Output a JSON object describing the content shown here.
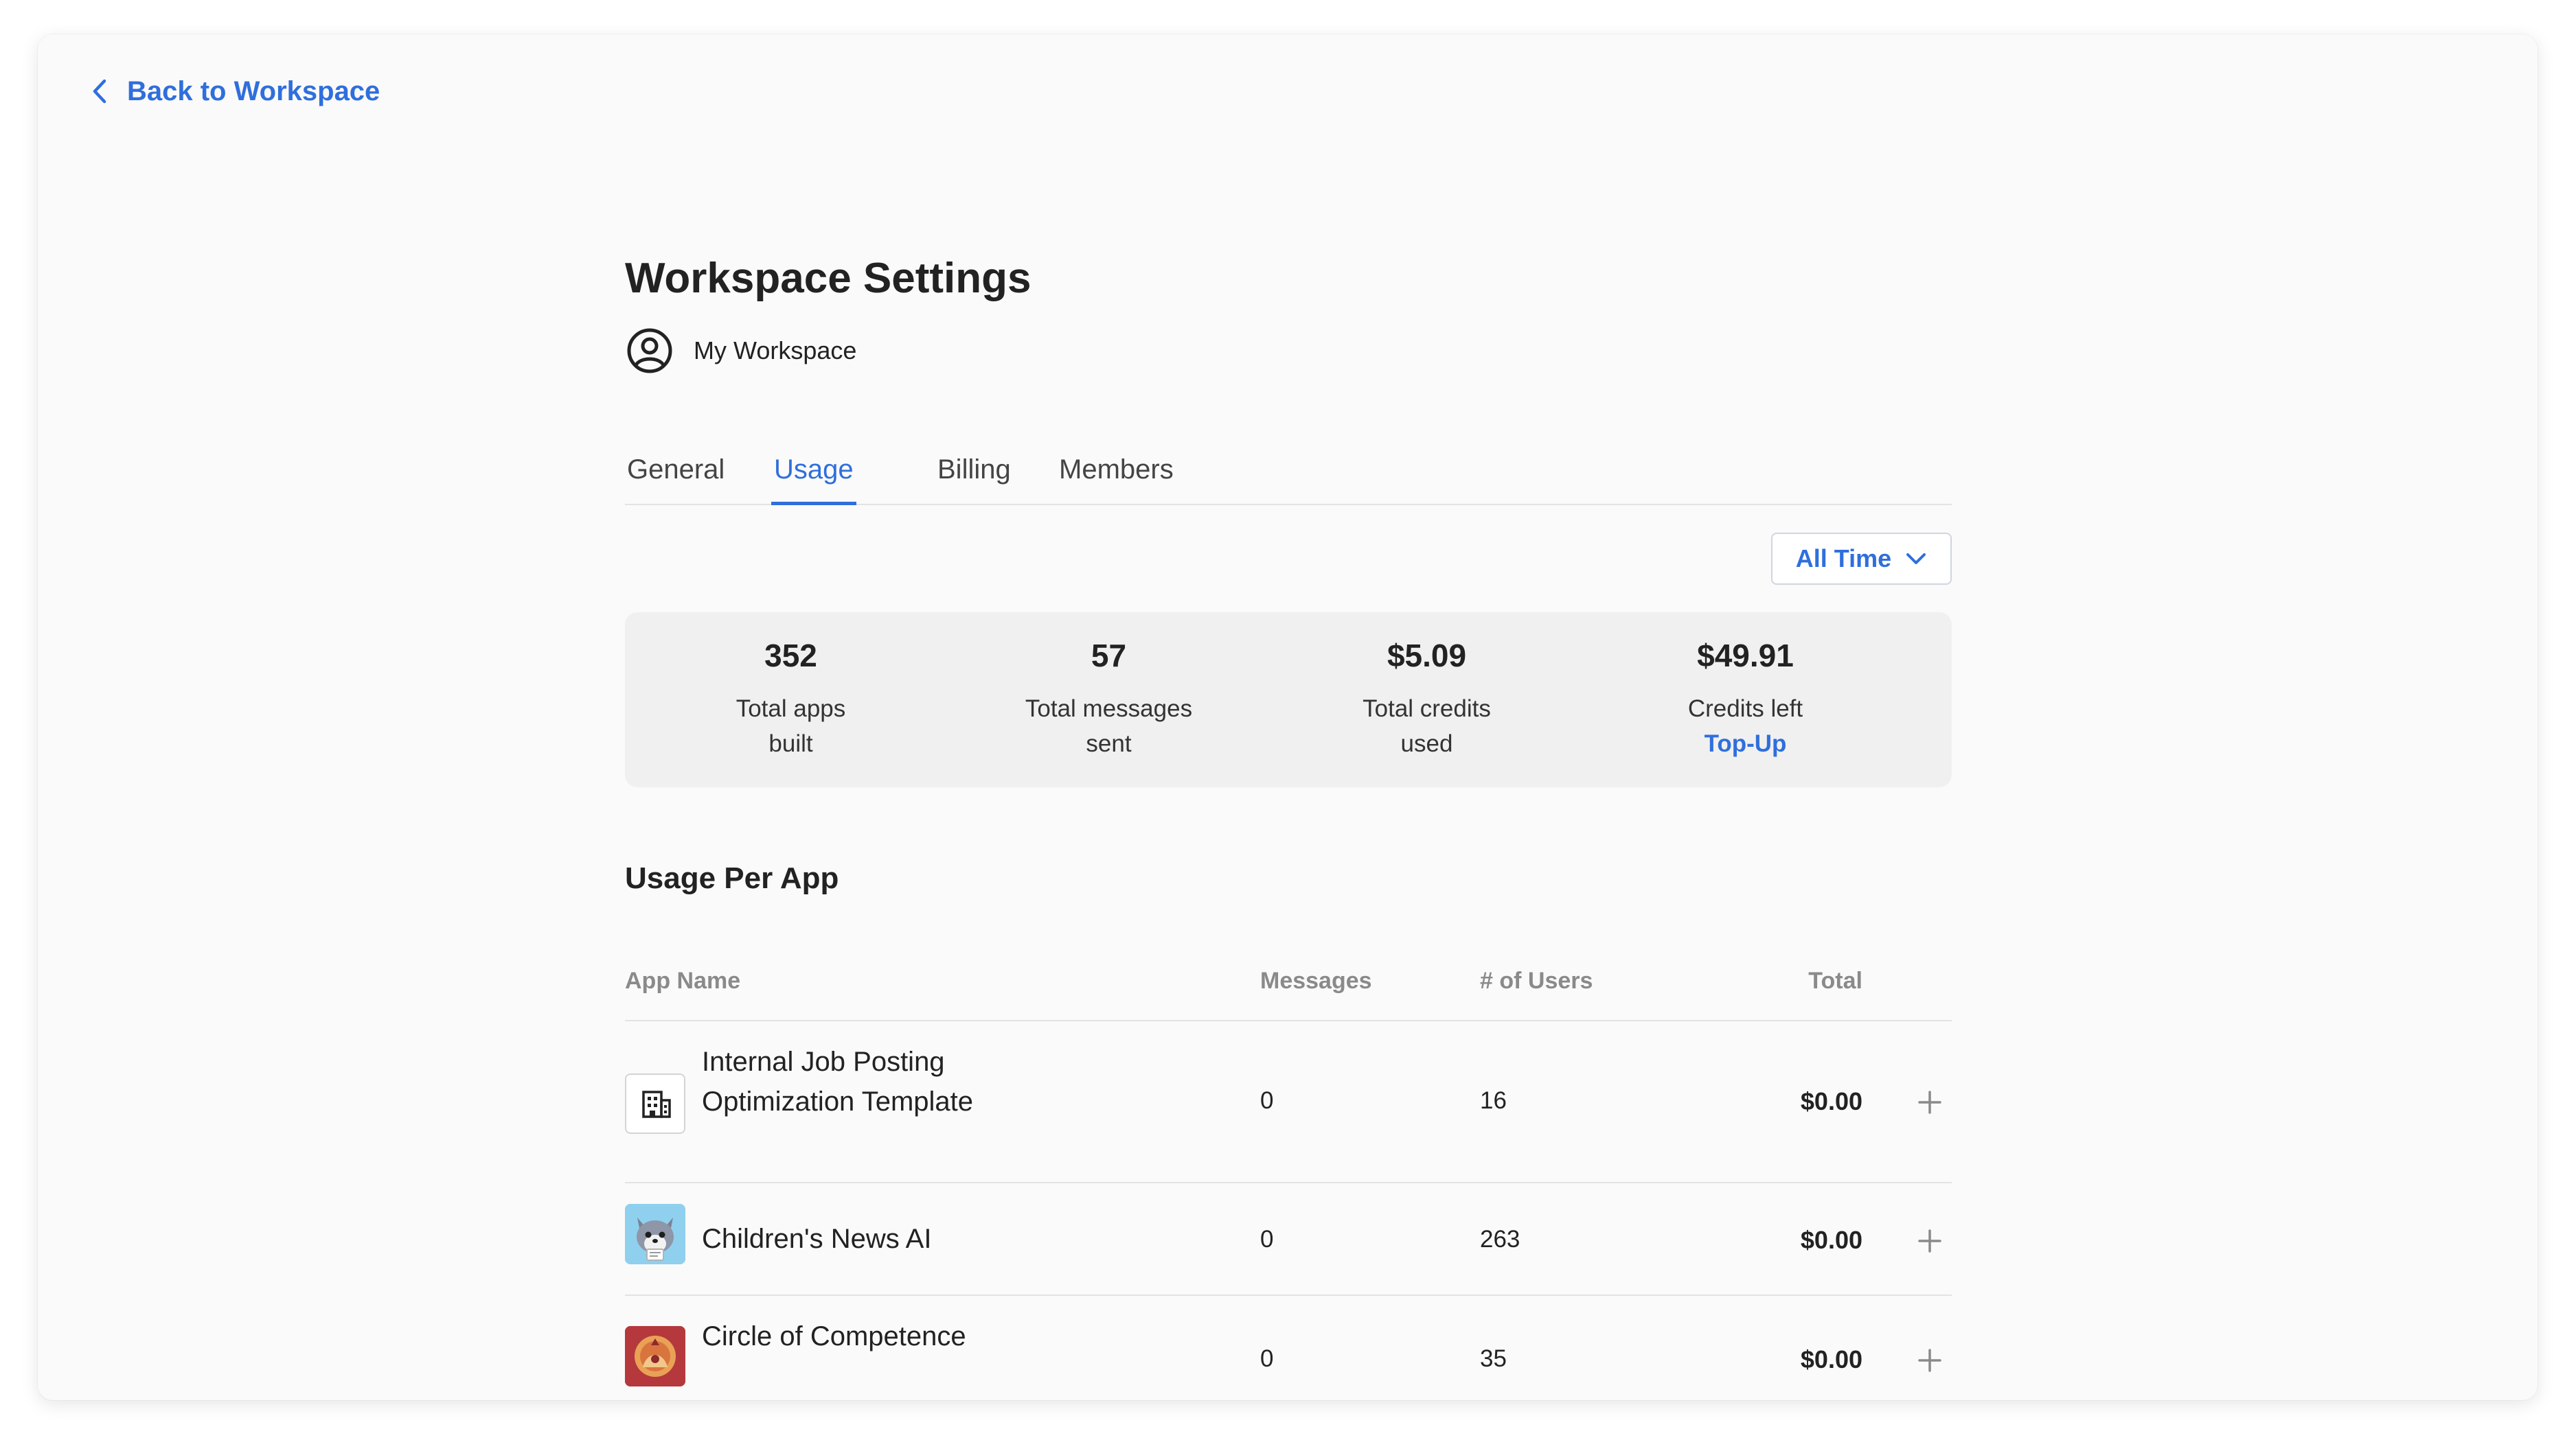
{
  "nav": {
    "back_label": "Back to Workspace"
  },
  "header": {
    "title": "Workspace Settings",
    "workspace_name": "My Workspace"
  },
  "tabs": [
    {
      "label": "General",
      "active": false
    },
    {
      "label": "Usage",
      "active": true
    },
    {
      "label": "Billing",
      "active": false
    },
    {
      "label": "Members",
      "active": false
    }
  ],
  "filter": {
    "selected": "All Time"
  },
  "stats": [
    {
      "value": "352",
      "label_line1": "Total apps",
      "label_line2": "built"
    },
    {
      "value": "57",
      "label_line1": "Total messages",
      "label_line2": "sent"
    },
    {
      "value": "$5.09",
      "label_line1": "Total credits",
      "label_line2": "used"
    },
    {
      "value": "$49.91",
      "label_line1": "Credits left",
      "action": "Top-Up"
    }
  ],
  "usage_table": {
    "section_title": "Usage Per App",
    "columns": {
      "app_name": "App Name",
      "messages": "Messages",
      "users": "# of Users",
      "total": "Total"
    },
    "rows": [
      {
        "app_name": "Internal Job Posting Optimization Template",
        "messages": "0",
        "users": "16",
        "total": "$0.00",
        "icon": "building-icon"
      },
      {
        "app_name": "Children's News AI",
        "messages": "0",
        "users": "263",
        "total": "$0.00",
        "icon": "wolf-avatar-icon"
      },
      {
        "app_name": "Circle of Competence",
        "messages": "0",
        "users": "35",
        "total": "$0.00",
        "icon": "circle-art-icon"
      }
    ]
  },
  "colors": {
    "accent": "#2f6fdc",
    "background": "#fafafa",
    "card": "#f0f0f0"
  }
}
